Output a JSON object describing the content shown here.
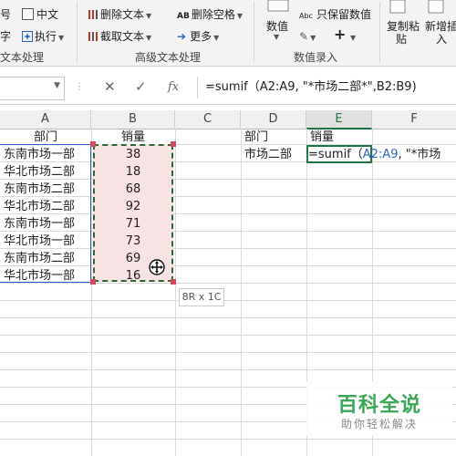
{
  "ribbon": {
    "row1": {
      "hao": "号",
      "zhongwen": "中文",
      "del_text": "删除文本",
      "del_space": "删除空格",
      "value": "数值",
      "keep_num": "只保留数值",
      "copy_paste": "复制粘",
      "add_worksheet": "新增插"
    },
    "row2": {
      "zi": "字",
      "execute": "执行",
      "extract_text": "截取文本",
      "more": "更多",
      "paste": "贴",
      "insert": "入"
    },
    "groups": {
      "text_process": "文本处理",
      "adv_text_process": "高级文本处理",
      "value_entry": "数值录入"
    },
    "abc_small": "Abc"
  },
  "formula_bar": {
    "fx": "fx",
    "formula": "=sumif（A2:A9,  \"*市场二部*\",B2:B9)"
  },
  "columns": [
    "A",
    "B",
    "C",
    "D",
    "E",
    "F"
  ],
  "sheet": {
    "headers": {
      "a": "部门",
      "b": "销量",
      "d": "部门",
      "e": "销量"
    },
    "rows": [
      {
        "dept": "东南市场一部",
        "sales": "38"
      },
      {
        "dept": "华北市场二部",
        "sales": "18"
      },
      {
        "dept": "东南市场二部",
        "sales": "68"
      },
      {
        "dept": "华北市场二部",
        "sales": "92"
      },
      {
        "dept": "东南市场一部",
        "sales": "71"
      },
      {
        "dept": "华北市场一部",
        "sales": "73"
      },
      {
        "dept": "东南市场二部",
        "sales": "69"
      },
      {
        "dept": "华北市场一部",
        "sales": "16"
      }
    ],
    "d2": "市场二部",
    "e2_prefix": "=sumif（",
    "e2_ref": "A2:A9",
    "e2_suffix": ",  \"*市场",
    "size_tip": "8R x 1C"
  },
  "watermark": {
    "title": "百科全说",
    "subtitle": "助你轻松解决"
  },
  "colors": {
    "accent": "#217346",
    "copy_border": "#2e6a38",
    "selection_fill": "#f7e3e3",
    "ref_blue": "#2f62c5",
    "watermark_green": "#3aa757"
  }
}
